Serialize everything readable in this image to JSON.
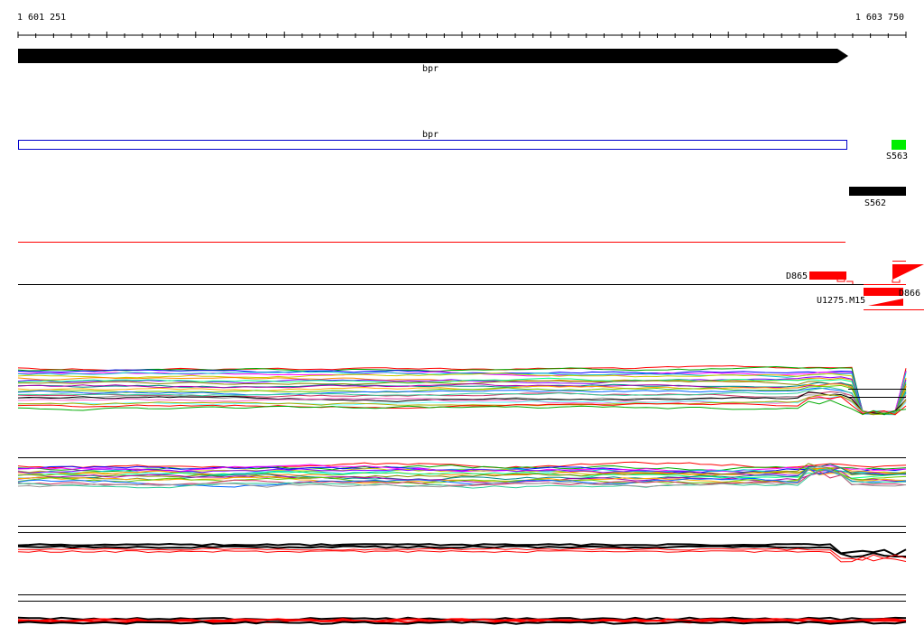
{
  "scale": {
    "start_label": "1 601 251",
    "end_label": "1 603 750"
  },
  "genes": {
    "gene_label": "bpr",
    "cds_label": "bpr"
  },
  "features": {
    "s563": "S563",
    "s562": "S562",
    "d865": "D865",
    "d866": "D866",
    "u1275": "U1275.M15"
  },
  "colors": {
    "gene_arrow": "#000000",
    "cds_box": "#0000cc",
    "s563": "#00ee00",
    "s562": "#000000",
    "signal_red": "#ff0000"
  }
}
